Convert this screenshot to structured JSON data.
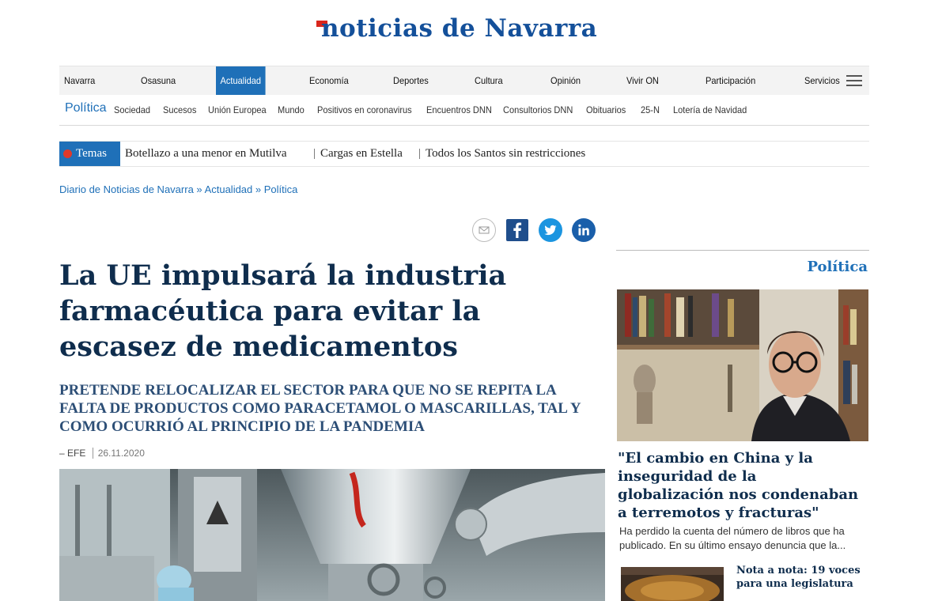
{
  "logo": {
    "text": "noticias de Navarra"
  },
  "main_nav": {
    "items": [
      "Navarra",
      "Osasuna",
      "Actualidad",
      "Economía",
      "Deportes",
      "Cultura",
      "Opinión",
      "Vivir ON",
      "Participación",
      "Servicios"
    ],
    "active": "Actualidad"
  },
  "sub_nav": {
    "section": "Política",
    "items": [
      "Sociedad",
      "Sucesos",
      "Unión Europea",
      "Mundo",
      "Positivos en coronavirus",
      "Encuentros DNN",
      "Consultorios DNN",
      "Obituarios",
      "25-N",
      "Lotería de Navidad"
    ]
  },
  "temas": {
    "label": "Temas",
    "items": [
      "Botellazo a una menor en Mutilva",
      "Cargas en Estella",
      "Todos los Santos sin restricciones"
    ]
  },
  "breadcrumb": {
    "items": [
      "Diario de Noticias de Navarra",
      "Actualidad",
      "Política"
    ],
    "separator": "»"
  },
  "article": {
    "headline": "La UE impulsará la industria farmacéutica para evitar la escasez de medicamentos",
    "subhead": "Pretende relocalizar el sector para que no se repita la falta de productos como paracetamol o mascarillas, tal y como ocurrió al principio de la pandemia",
    "author": "– EFE",
    "date": "26.11.2020"
  },
  "sidebar": {
    "section": "Política",
    "main_title": "\"El cambio en China y la inseguridad de la globalización nos condenaban a terremotos y fracturas\"",
    "main_excerpt": "Ha perdido la cuenta del número de libros que ha publicado. En su último ensayo denuncia que la...",
    "small_title": "Nota a nota: 19 voces para una legislatura"
  },
  "colors": {
    "brand_blue": "#1f70b8",
    "accent_red": "#d9261c",
    "headline_navy": "#0f2d4d"
  },
  "icons": [
    "email-icon",
    "facebook-icon",
    "twitter-icon",
    "linkedin-icon",
    "hamburger-menu-icon"
  ]
}
